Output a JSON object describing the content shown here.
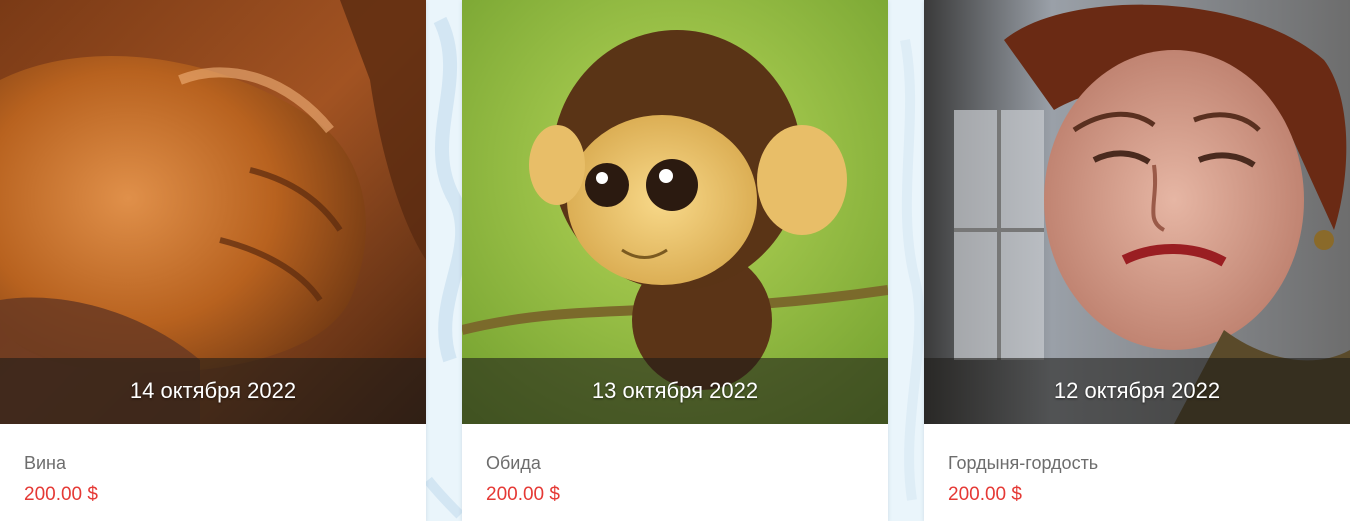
{
  "products": [
    {
      "date": "14 октября 2022",
      "title": "Вина",
      "price": "200.00 $"
    },
    {
      "date": "13 октября 2022",
      "title": "Обида",
      "price": "200.00 $"
    },
    {
      "date": "12 октября 2022",
      "title": "Гордыня-гордость",
      "price": "200.00 $"
    }
  ],
  "colors": {
    "price": "#e53935",
    "title": "#6d6d6d",
    "page_background": "#eaf5fb"
  }
}
